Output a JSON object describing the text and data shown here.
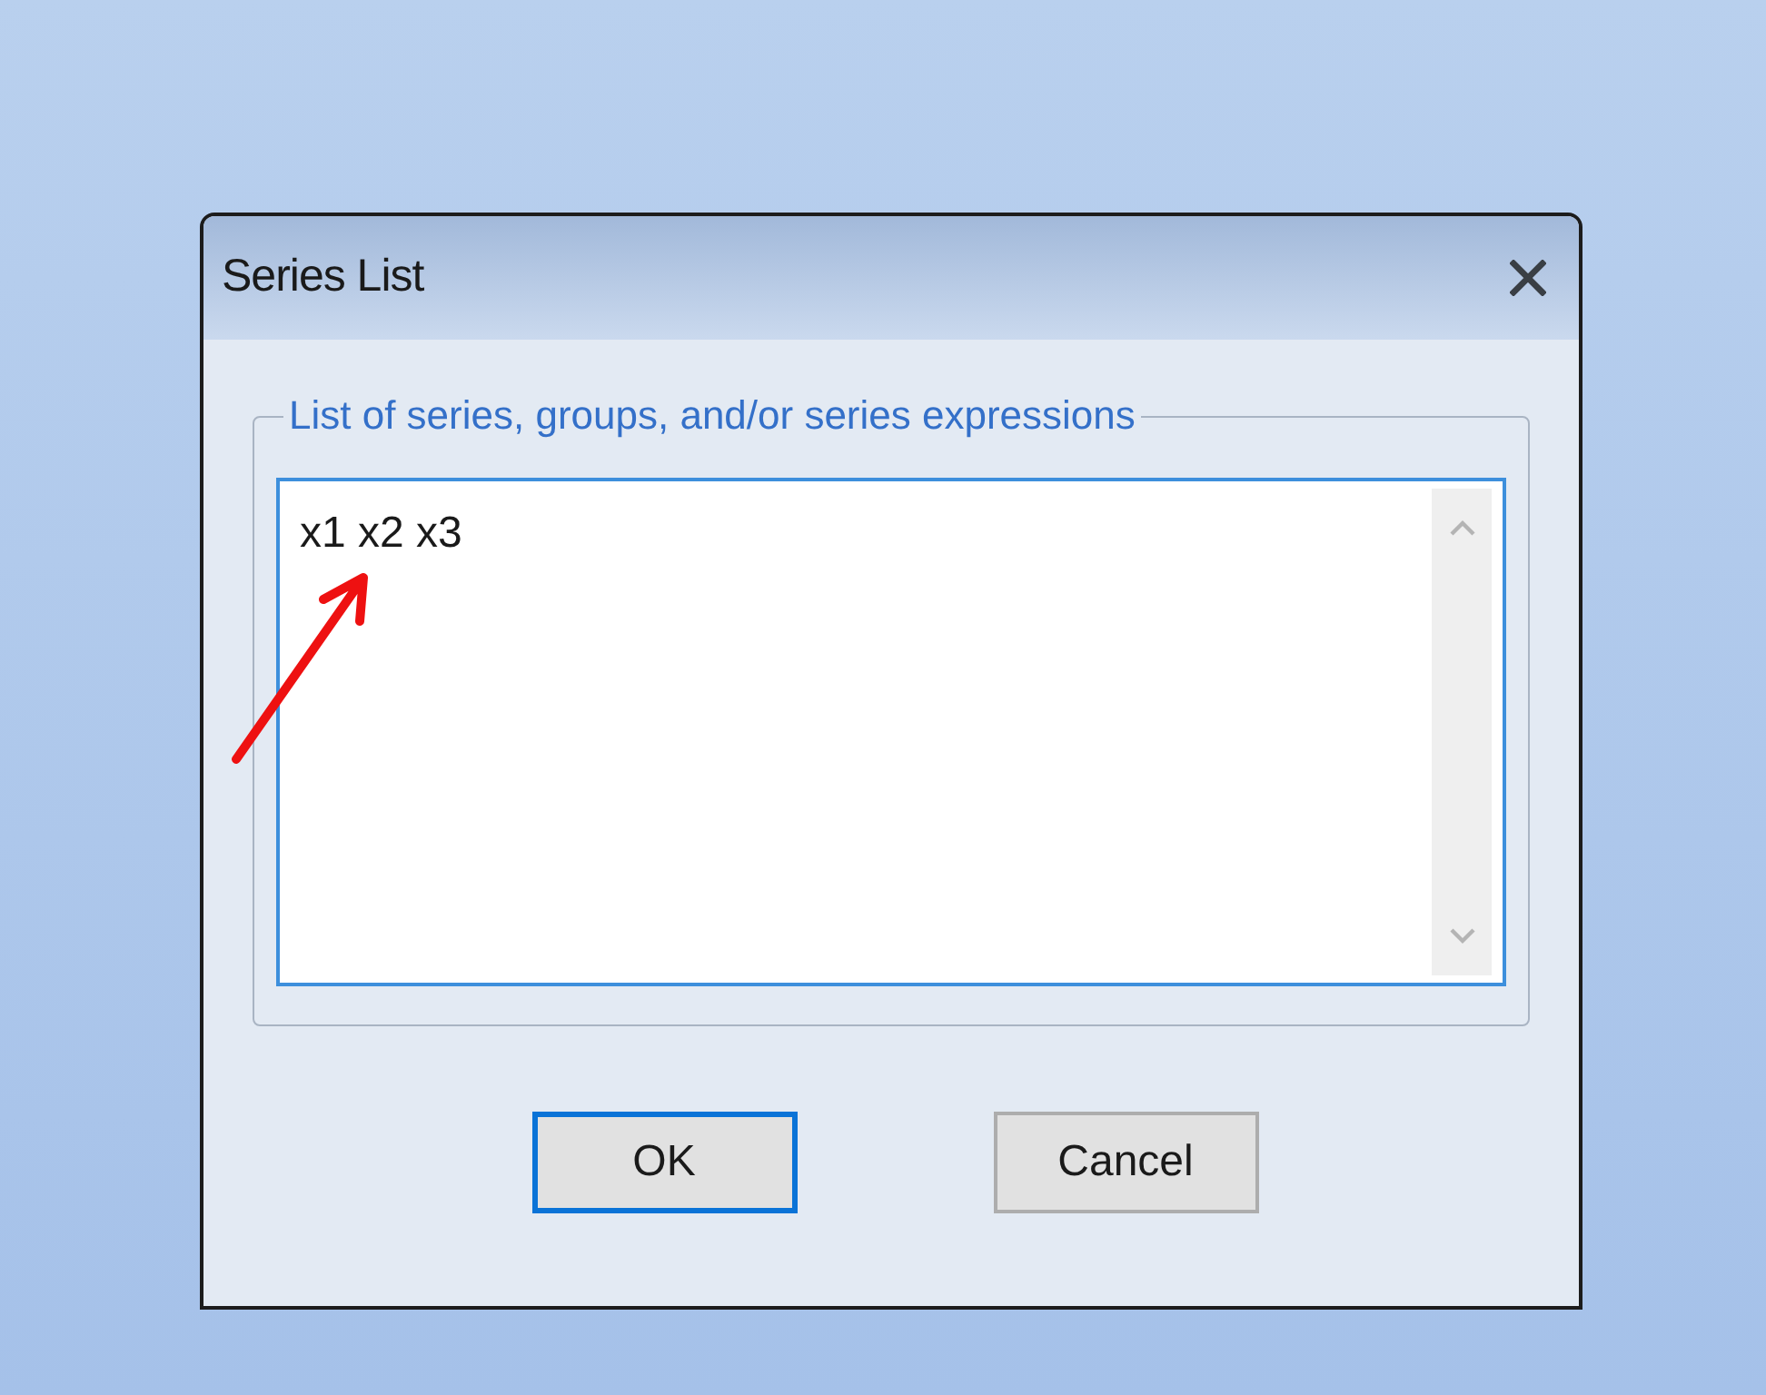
{
  "window": {
    "title": "Series List"
  },
  "group": {
    "legend": "List of series, groups, and/or series expressions"
  },
  "series_field": {
    "value": "x1 x2 x3"
  },
  "buttons": [
    {
      "label": "OK",
      "default": true
    },
    {
      "label": "Cancel",
      "default": false
    }
  ]
}
